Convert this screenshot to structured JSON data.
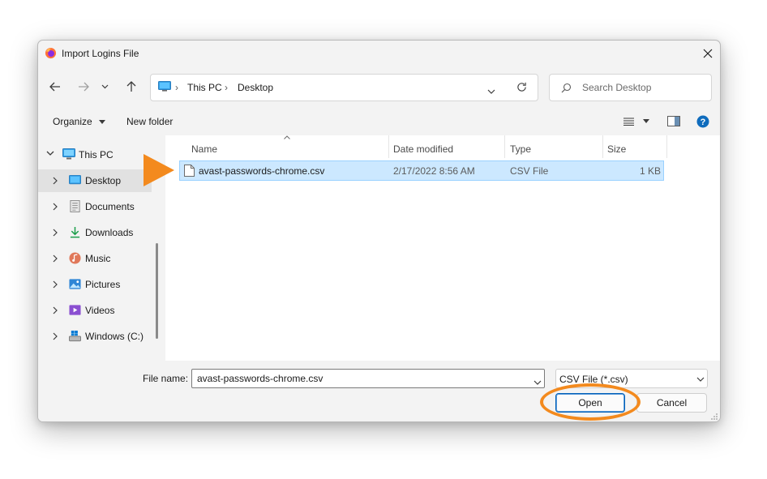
{
  "window": {
    "title": "Import Logins File"
  },
  "address": {
    "crumbs": [
      "This PC",
      "Desktop"
    ]
  },
  "search": {
    "placeholder": "Search Desktop"
  },
  "toolbar": {
    "organize_label": "Organize",
    "new_folder_label": "New folder"
  },
  "sidebar": {
    "items": [
      {
        "label": "This PC",
        "icon": "computer-icon",
        "expanded": true
      },
      {
        "label": "Desktop",
        "icon": "desktop-folder-icon",
        "selected": true
      },
      {
        "label": "Documents",
        "icon": "documents-folder-icon"
      },
      {
        "label": "Downloads",
        "icon": "downloads-folder-icon"
      },
      {
        "label": "Music",
        "icon": "music-folder-icon"
      },
      {
        "label": "Pictures",
        "icon": "pictures-folder-icon"
      },
      {
        "label": "Videos",
        "icon": "videos-folder-icon"
      },
      {
        "label": "Windows (C:)",
        "icon": "drive-icon"
      }
    ]
  },
  "file_list": {
    "columns": [
      "Name",
      "Date modified",
      "Type",
      "Size"
    ],
    "rows": [
      {
        "name": "avast-passwords-chrome.csv",
        "date": "2/17/2022 8:56 AM",
        "type": "CSV File",
        "size": "1 KB",
        "selected": true
      }
    ]
  },
  "footer": {
    "file_name_label": "File name:",
    "file_name_value": "avast-passwords-chrome.csv",
    "file_type_value": "CSV File (*.csv)",
    "open_label": "Open",
    "cancel_label": "Cancel"
  },
  "colors": {
    "accent": "#005fb8",
    "selection": "#cce8ff",
    "highlight_annotation": "#f38a1e",
    "help_icon": "#0f6cbd"
  }
}
